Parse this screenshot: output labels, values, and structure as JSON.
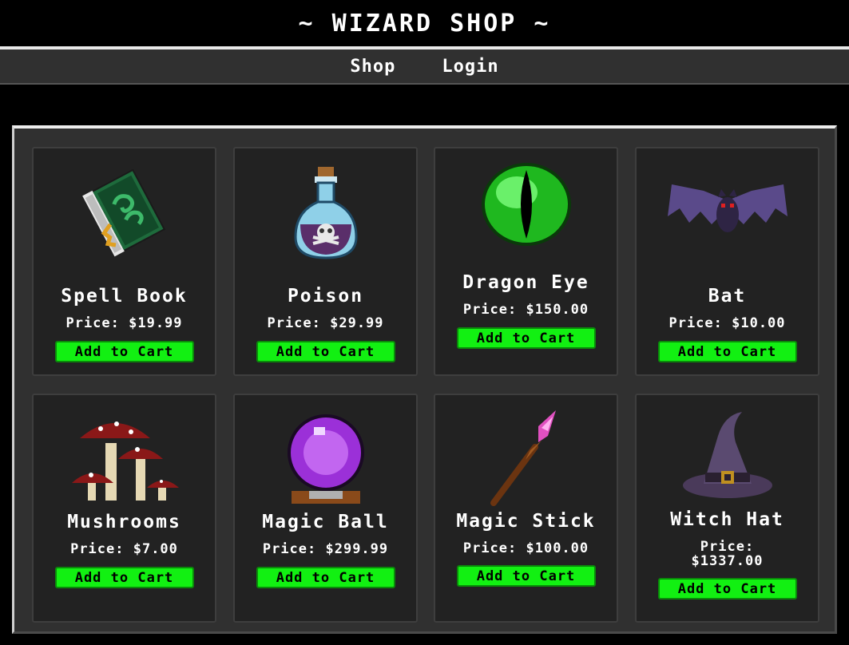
{
  "header": {
    "title": "~ WIZARD SHOP ~"
  },
  "nav": {
    "shop_label": "Shop",
    "login_label": "Login"
  },
  "products": [
    {
      "name": "Spell Book",
      "price": "Price: $19.99",
      "button": "Add to Cart",
      "icon": "spell-book-icon"
    },
    {
      "name": "Poison",
      "price": "Price: $29.99",
      "button": "Add to Cart",
      "icon": "poison-icon"
    },
    {
      "name": "Dragon Eye",
      "price": "Price: $150.00",
      "button": "Add to Cart",
      "icon": "dragon-eye-icon"
    },
    {
      "name": "Bat",
      "price": "Price: $10.00",
      "button": "Add to Cart",
      "icon": "bat-icon"
    },
    {
      "name": "Mushrooms",
      "price": "Price: $7.00",
      "button": "Add to Cart",
      "icon": "mushrooms-icon"
    },
    {
      "name": "Magic Ball",
      "price": "Price: $299.99",
      "button": "Add to Cart",
      "icon": "crystal-ball-icon"
    },
    {
      "name": "Magic Stick",
      "price": "Price: $100.00",
      "button": "Add to Cart",
      "icon": "magic-wand-icon"
    },
    {
      "name": "Witch Hat",
      "price": "Price:\n$1337.00",
      "button": "Add to Cart",
      "icon": "witch-hat-icon"
    }
  ],
  "colors": {
    "background": "#000000",
    "panel": "#303030",
    "card": "#222222",
    "button": "#12f012",
    "text": "#ffffff"
  }
}
